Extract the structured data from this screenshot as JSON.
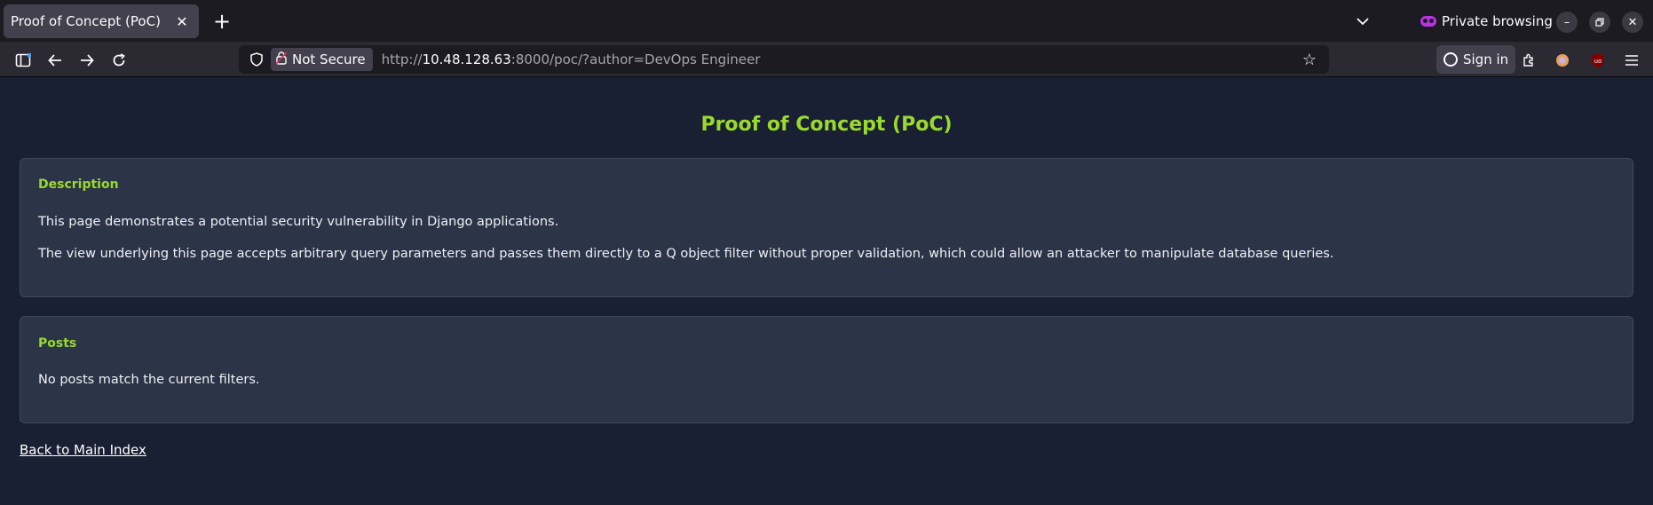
{
  "browser": {
    "tab_title": "Proof of Concept (PoC)",
    "private_label": "Private browsing",
    "not_secure_label": "Not Secure",
    "url_prefix": "http://",
    "url_host": "10.48.128.63",
    "url_rest": ":8000/poc/?author=DevOps Engineer",
    "sign_in_label": "Sign in"
  },
  "page": {
    "title": "Proof of Concept (PoC)",
    "description": {
      "heading": "Description",
      "para1": "This page demonstrates a potential security vulnerability in Django applications.",
      "para2": "The view underlying this page accepts arbitrary query parameters and passes them directly to a Q object filter without proper validation, which could allow an attacker to manipulate database queries."
    },
    "posts": {
      "heading": "Posts",
      "empty_message": "No posts match the current filters."
    },
    "back_link": "Back to Main Index"
  },
  "colors": {
    "accent": "#9ad92e",
    "background": "#1a2033",
    "card": "#2c3447"
  }
}
